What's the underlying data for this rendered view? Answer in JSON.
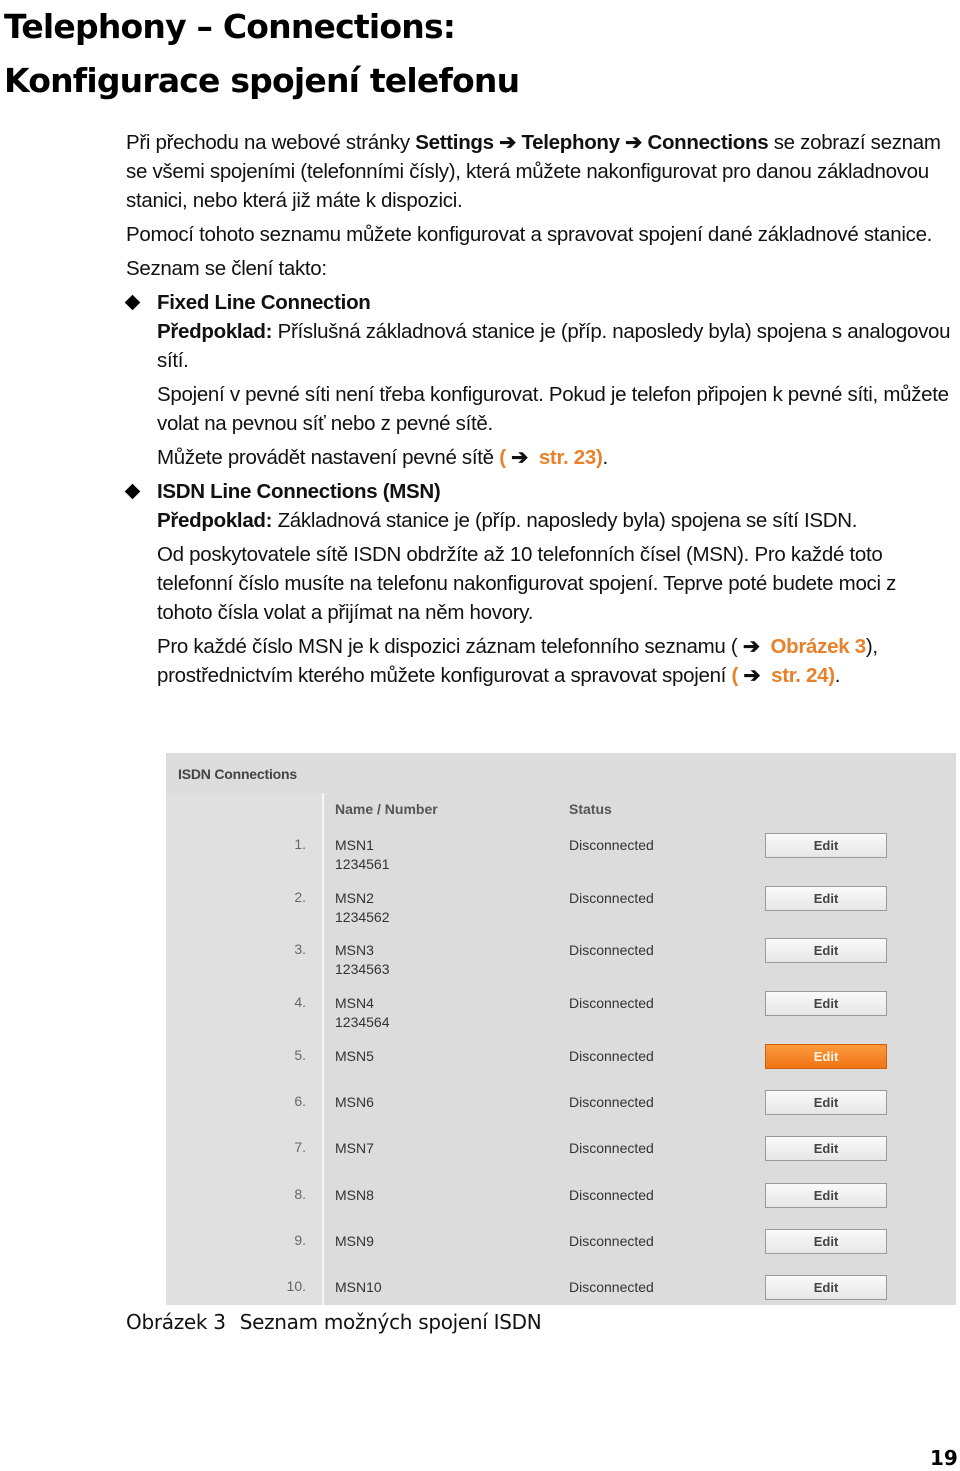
{
  "title": {
    "line1": "Telephony – Connections:",
    "line2": "Konfigurace spojení telefonu"
  },
  "intro": {
    "p1_prefix": "Při přechodu na webové stránky ",
    "p1_path1": "Settings",
    "p1_path2": "Telephony",
    "p1_path3": "Connections",
    "p1_suffix": " se zobrazí seznam se všemi spojeními (telefonními čísly), která můžete nakonfigurovat pro danou základnovou stanici, nebo která již máte k dispozici.",
    "p2": "Pomocí tohoto seznamu můžete konfigurovat a spravovat spojení dané základnové stanice.",
    "p3": "Seznam se člení takto:",
    "arrow": "➔"
  },
  "items": [
    {
      "heading": "Fixed Line Connection",
      "prereq_label": "Předpoklad:",
      "prereq_text": " Příslušná základnová stanice je (příp. naposledy byla) spojena s analogovou sítí.",
      "p1": "Spojení v pevné síti není třeba konfigurovat. Pokud je telefon připojen k pevné síti, můžete volat na pevnou síť nebo z pevné sítě.",
      "p2_prefix": "Můžete provádět nastavení pevné sítě ",
      "p2_link": "str. 23",
      "p2_suffix": "."
    },
    {
      "heading": "ISDN Line Connections (MSN)",
      "prereq_label": "Předpoklad:",
      "prereq_text": " Základnová stanice je (příp. naposledy byla) spojena se sítí ISDN.",
      "p1": "Od poskytovatele sítě ISDN obdržíte až 10 telefonních čísel (MSN). Pro každé toto telefonní číslo musíte na telefonu nakonfigurovat spojení. Teprve poté budete moci z tohoto čísla volat a přijímat na něm hovory.",
      "p2_prefix": "Pro každé číslo MSN je k dispozici záznam telefonního seznamu ( ",
      "p2_link1": "Obrázek 3",
      "p2_mid": "), prostřednictvím kterého můžete konfigurovat a spravovat spojení ",
      "p2_link2": "str. 24",
      "p2_suffix": "."
    }
  ],
  "screenshot": {
    "title": "ISDN Connections",
    "col_name": "Name / Number",
    "col_status": "Status",
    "edit_label": "Edit",
    "active_color": "#f58220",
    "rows": [
      {
        "num": "1.",
        "name": "MSN1",
        "number": "1234561",
        "status": "Disconnected",
        "active": false
      },
      {
        "num": "2.",
        "name": "MSN2",
        "number": "1234562",
        "status": "Disconnected",
        "active": false
      },
      {
        "num": "3.",
        "name": "MSN3",
        "number": "1234563",
        "status": "Disconnected",
        "active": false
      },
      {
        "num": "4.",
        "name": "MSN4",
        "number": "1234564",
        "status": "Disconnected",
        "active": false
      },
      {
        "num": "5.",
        "name": "MSN5",
        "number": "",
        "status": "Disconnected",
        "active": true
      },
      {
        "num": "6.",
        "name": "MSN6",
        "number": "",
        "status": "Disconnected",
        "active": false
      },
      {
        "num": "7.",
        "name": "MSN7",
        "number": "",
        "status": "Disconnected",
        "active": false
      },
      {
        "num": "8.",
        "name": "MSN8",
        "number": "",
        "status": "Disconnected",
        "active": false
      },
      {
        "num": "9.",
        "name": "MSN9",
        "number": "",
        "status": "Disconnected",
        "active": false
      },
      {
        "num": "10.",
        "name": "MSN10",
        "number": "",
        "status": "Disconnected",
        "active": false
      }
    ]
  },
  "caption": {
    "label": "Obrázek 3",
    "text": "Seznam možných spojení ISDN"
  },
  "page_number": "19"
}
